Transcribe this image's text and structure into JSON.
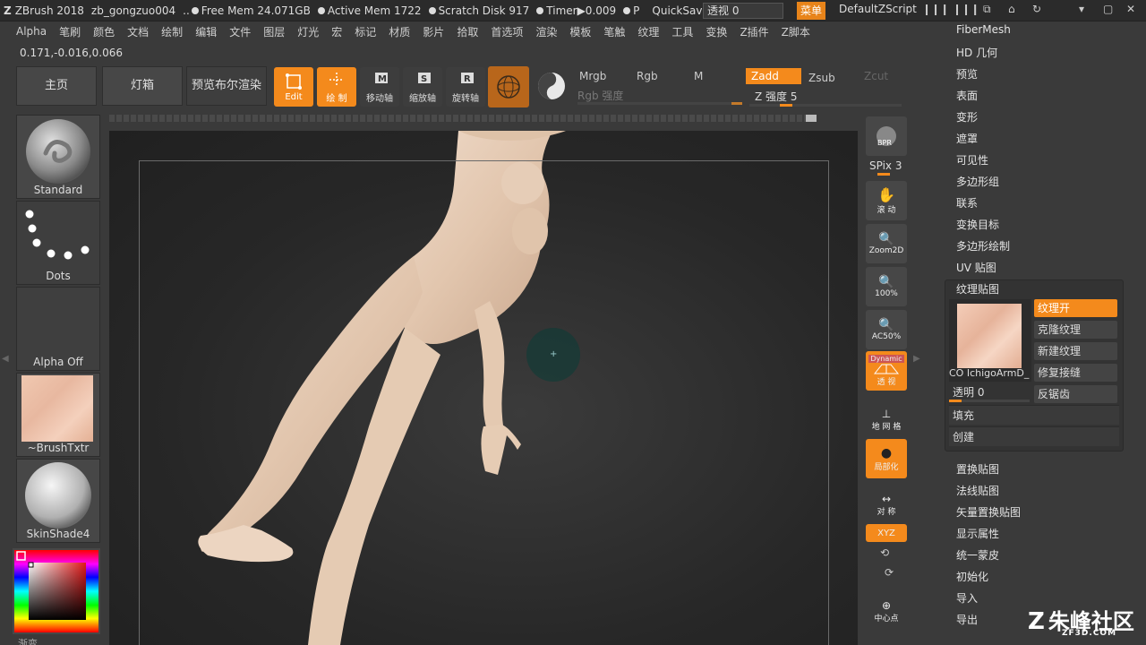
{
  "titlebar": {
    "app": "ZBrush 2018",
    "doc": "zb_gongzuo004",
    "ellipsis": "..",
    "free_mem": "Free Mem 24.071GB",
    "active_mem": "Active Mem 1722",
    "scratch": "Scratch Disk 917",
    "timer": "Timer▶0.009",
    "p": "P",
    "quicksave": "QuickSave",
    "transparency": "透视  0",
    "menu_btn": "菜单",
    "script": "DefaultZScript"
  },
  "menubar": [
    "Alpha",
    "笔刷",
    "颜色",
    "文档",
    "绘制",
    "编辑",
    "文件",
    "图层",
    "灯光",
    "宏",
    "标记",
    "材质",
    "影片",
    "拾取",
    "首选项",
    "渲染",
    "模板",
    "笔触",
    "纹理",
    "工具",
    "变换",
    "Z插件",
    "Z脚本"
  ],
  "coords": "0.171,-0.016,0.066",
  "shelf": {
    "home": "主页",
    "lightbox": "灯箱",
    "bpr_preview": "预览布尔渲染",
    "edit": "Edit",
    "draw": "绘 制",
    "move": "移动轴",
    "scale": "缩放轴",
    "rotate": "旋转轴",
    "mrgb": "Mrgb",
    "rgb": "Rgb",
    "m": "M",
    "zadd": "Zadd",
    "zsub": "Zsub",
    "zcut": "Zcut",
    "rgb_intensity": "Rgb 强度",
    "z_intensity": "Z 强度  5"
  },
  "left_tray": {
    "brush": "Standard",
    "stroke": "Dots",
    "alpha": "Alpha Off",
    "texture": "~BrushTxtr",
    "material": "SkinShade4",
    "gradient": "渐变"
  },
  "right_tools": {
    "bpr": "BPR",
    "spix": "SPix 3",
    "scroll": "滚 动",
    "zoom2d": "Zoom2D",
    "actual": "100%",
    "ac50": "AC50%",
    "dynamic": "Dynamic",
    "persp": "透 视",
    "floor": "地 网 格",
    "local": "局部化",
    "sym": "对 称",
    "xyz": "XYZ",
    "center": "中心点"
  },
  "right_panel": {
    "top_items": [
      "FiberMesh",
      "HD 几何",
      "预览",
      "表面",
      "变形",
      "遮罩",
      "可见性",
      "多边形组",
      "联系",
      "变换目标",
      "多边形绘制",
      "UV 贴图"
    ],
    "texture_map_header": "纹理贴图",
    "texture_name": "CO IchigoArmD_",
    "texture_on": "纹理开",
    "clone_texture": "克隆纹理",
    "new_texture": "新建纹理",
    "fix_seam": "修复接缝",
    "transparent": "透明  0",
    "antialias": "反锯齿",
    "fill": "填充",
    "create": "创建",
    "bottom_items": [
      "置换贴图",
      "法线贴图",
      "矢量置换贴图",
      "显示属性",
      "统一蒙皮",
      "初始化",
      "导入",
      "导出"
    ]
  },
  "watermark": {
    "name": "朱峰社区",
    "url": "ZF3D.COM"
  },
  "colors": {
    "accent": "#f48a1c",
    "panel": "#3a3a3a",
    "skin": "#e4c8b0"
  }
}
